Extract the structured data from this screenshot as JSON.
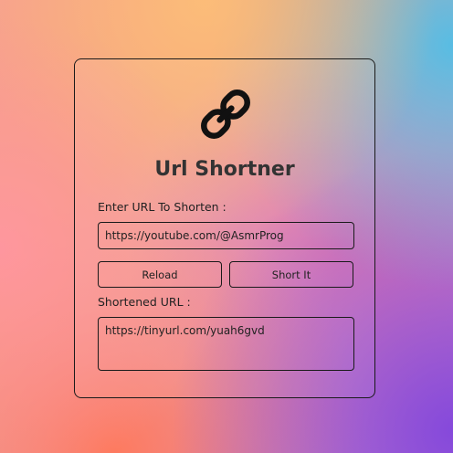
{
  "app": {
    "title": "Url Shortner",
    "logo_icon": "link-icon"
  },
  "form": {
    "input_label": "Enter URL To Shorten :",
    "input_value": "https://youtube.com/@AsmrProg",
    "reload_label": "Reload",
    "short_label": "Short It",
    "output_label": "Shortened URL :",
    "output_value": "https://tinyurl.com/yuah6gvd"
  },
  "colors": {
    "text": "#333333",
    "border": "#1a1a1a"
  }
}
